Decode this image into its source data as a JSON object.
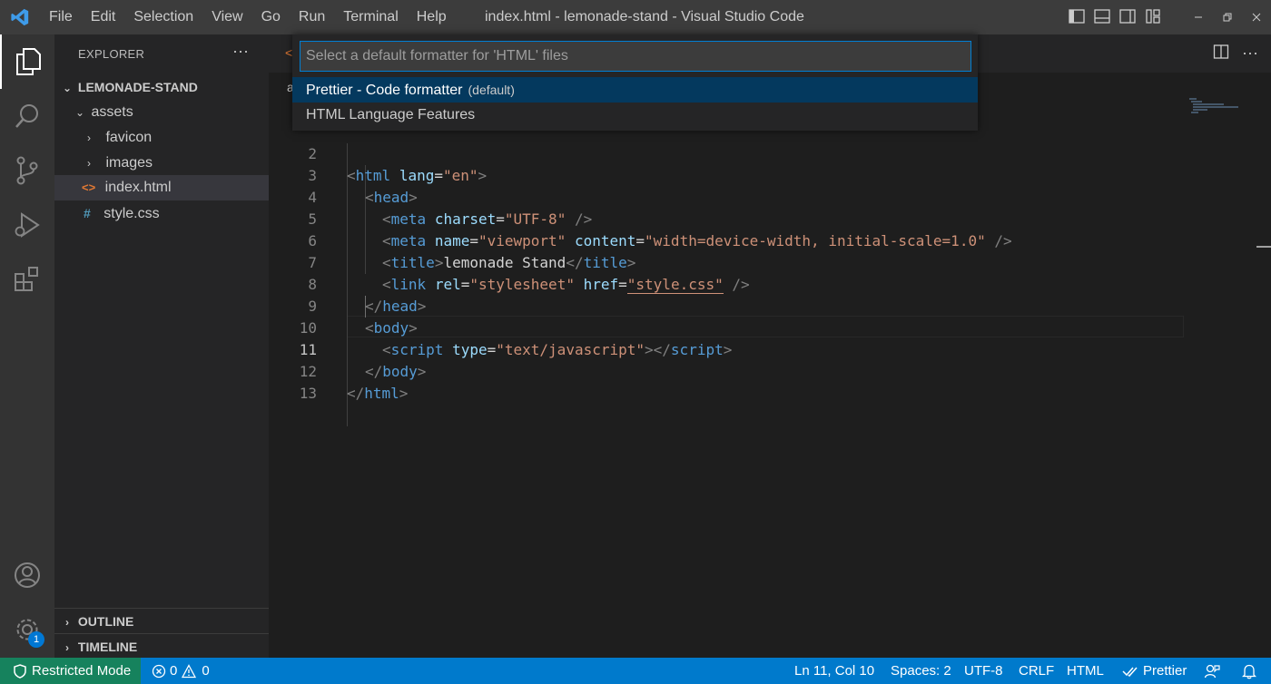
{
  "titlebar": {
    "menu": [
      "File",
      "Edit",
      "Selection",
      "View",
      "Go",
      "Run",
      "Terminal",
      "Help"
    ],
    "title": "index.html - lemonade-stand - Visual Studio Code"
  },
  "activity": {
    "settings_badge": "1"
  },
  "sidebar": {
    "header": "EXPLORER",
    "more": "···",
    "root": "LEMONADE-STAND",
    "tree": [
      {
        "label": "assets",
        "chevron": "⌄"
      },
      {
        "label": "favicon",
        "chevron": "›"
      },
      {
        "label": "images",
        "chevron": "›"
      },
      {
        "label": "index.html",
        "icon": "<>"
      },
      {
        "label": "style.css",
        "icon": "#"
      }
    ],
    "outline": "OUTLINE",
    "timeline": "TIMELINE"
  },
  "editor": {
    "tab_fragment": "<",
    "breadcrumb_fragment": "a",
    "line_numbers": [
      "2",
      "3",
      "4",
      "5",
      "6",
      "7",
      "8",
      "9",
      "10",
      "11",
      "12",
      "13"
    ],
    "line2": {
      "open": "<",
      "tag": "html",
      "attr": "lang",
      "eq": "=",
      "val": "\"en\"",
      "close": ">"
    },
    "line3": {
      "open": "<",
      "tag": "head",
      "close": ">"
    },
    "line4": {
      "open": "<",
      "tag": "meta",
      "attr": "charset",
      "eq": "=",
      "val": "\"UTF-8\"",
      "close": " />"
    },
    "line5": {
      "open": "<",
      "tag": "meta",
      "attr1": "name",
      "eq1": "=",
      "val1": "\"viewport\"",
      "attr2": "content",
      "eq2": "=",
      "val2": "\"width=device-width, initial-scale=1.0\"",
      "close": " />"
    },
    "line6": {
      "open": "<",
      "tag": "title",
      "close": ">",
      "text": "lemonade Stand",
      "endopen": "</",
      "endtag": "title",
      "endclose": ">"
    },
    "line7": {
      "open": "<",
      "tag": "link",
      "attr1": "rel",
      "eq1": "=",
      "val1": "\"stylesheet\"",
      "attr2": "href",
      "eq2": "=",
      "q1": "\"",
      "val2": "style.css",
      "q2": "\"",
      "close": " />"
    },
    "line8": {
      "open": "</",
      "tag": "head",
      "close": ">"
    },
    "line9": {
      "open": "<",
      "tag": "body",
      "close": ">"
    },
    "line10": {
      "open": "<",
      "tag": "script",
      "attr": "type",
      "eq": "=",
      "val": "\"text/javascript\"",
      "close": "></",
      "endtag": "script",
      "endclose": ">"
    },
    "line11": {
      "open": "</",
      "tag": "body",
      "close": ">"
    },
    "line12": {
      "open": "</",
      "tag": "html",
      "close": ">"
    }
  },
  "quickpick": {
    "placeholder": "Select a default formatter for 'HTML' files",
    "items": [
      {
        "label": "Prettier - Code formatter",
        "description": "(default)"
      },
      {
        "label": "HTML Language Features"
      }
    ]
  },
  "statusbar": {
    "restricted": "Restricted Mode",
    "errors": "0",
    "warnings": "0",
    "position": "Ln 11, Col 10",
    "spaces": "Spaces: 2",
    "encoding": "UTF-8",
    "eol": "CRLF",
    "language": "HTML",
    "formatter": "Prettier"
  },
  "colors": {
    "accent": "#007acc",
    "restricted_bg": "#16825d",
    "quickpick_selection": "#04395e"
  }
}
